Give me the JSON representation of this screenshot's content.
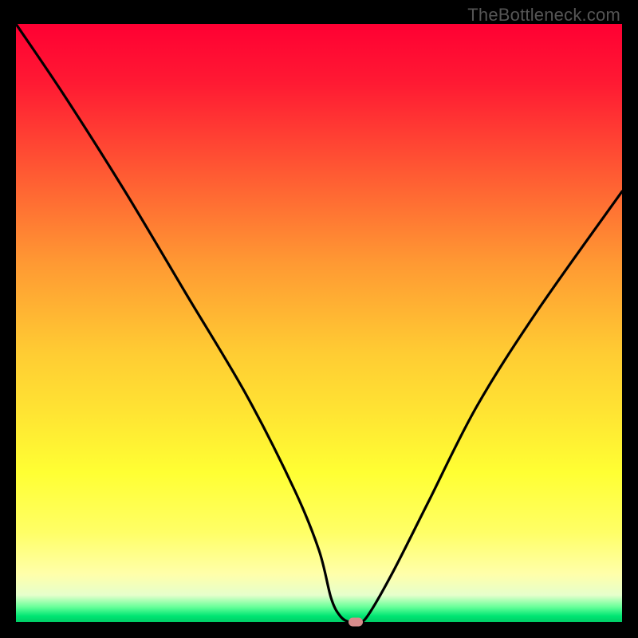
{
  "watermark": "TheBottleneck.com",
  "colors": {
    "frame_bg": "#000000",
    "curve_stroke": "#000000",
    "marker_fill": "#d98b8b"
  },
  "chart_data": {
    "type": "line",
    "title": "",
    "xlabel": "",
    "ylabel": "",
    "xlim": [
      0,
      100
    ],
    "ylim": [
      0,
      100
    ],
    "grid": false,
    "legend": false,
    "background": "vertical-gradient red→green (red top / green bottom)",
    "series": [
      {
        "name": "bottleneck-curve",
        "x": [
          0,
          8,
          18,
          28,
          38,
          46,
          50,
          52,
          53.5,
          55,
          56.5,
          58,
          62,
          68,
          76,
          86,
          100
        ],
        "values": [
          100,
          88,
          72,
          55,
          38,
          22,
          12,
          4,
          1,
          0,
          0,
          1,
          8,
          20,
          36,
          52,
          72
        ]
      }
    ],
    "marker": {
      "x": 56,
      "y": 0
    },
    "flat_bottom": {
      "x_start": 52,
      "x_end": 57,
      "value": 0
    }
  }
}
